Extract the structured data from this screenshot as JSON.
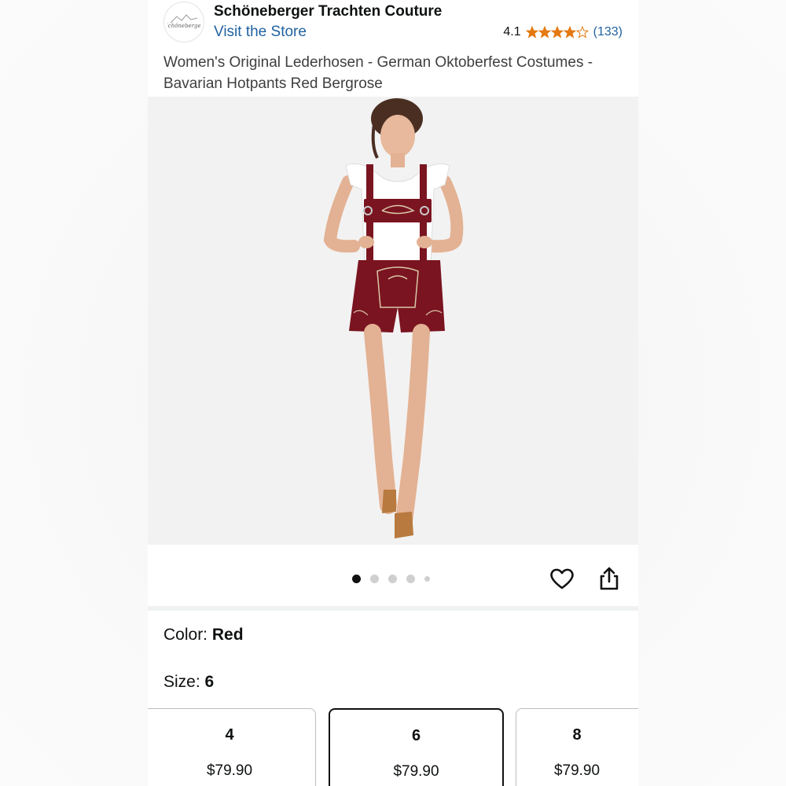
{
  "header": {
    "brand_name": "Schöneberger Trachten Couture",
    "logo_text": "Schöneberger",
    "visit_store": "Visit the Store",
    "rating_value": "4.1",
    "rating_stars": 4.1,
    "rating_count": "(133)",
    "star_color": "#e47911"
  },
  "product": {
    "title": "Women's Original Lederhosen - German Oktoberfest Costumes - Bavarian Hotpants Red Bergrose"
  },
  "carousel": {
    "dot_count": 5,
    "active_index": 0
  },
  "variants": {
    "color_label": "Color:",
    "color_value": "Red",
    "size_label": "Size:",
    "size_value": "6",
    "sizes": [
      {
        "size": "4",
        "price": "$79.90",
        "selected": false
      },
      {
        "size": "6",
        "price": "$79.90",
        "selected": true
      },
      {
        "size": "8",
        "price": "$79.90",
        "selected": false
      }
    ]
  },
  "icons": {
    "wishlist": "heart-icon",
    "share": "share-icon"
  },
  "colors": {
    "link": "#2162a1",
    "lederhosen_red": "#7a1420"
  }
}
